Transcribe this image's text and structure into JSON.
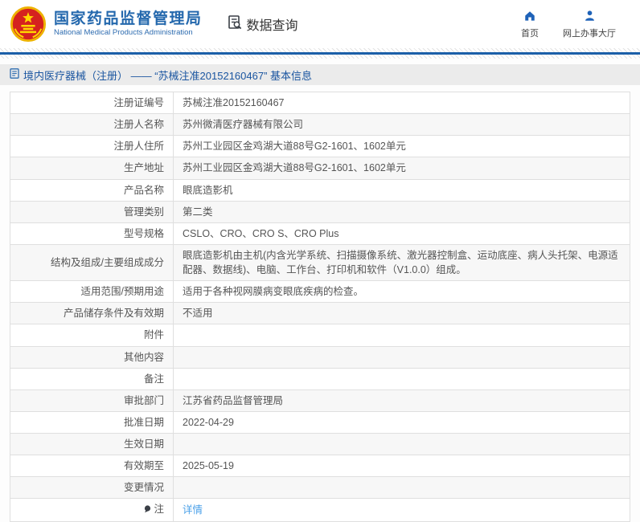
{
  "header": {
    "site_name_zh": "国家药品监督管理局",
    "site_name_en": "National Medical Products Administration",
    "section_title": "数据查询",
    "nav": [
      {
        "label": "首页",
        "icon": "home-icon"
      },
      {
        "label": "网上办事大厅",
        "icon": "person-icon"
      }
    ]
  },
  "breadcrumb": {
    "text": "境内医疗器械（注册） —— “苏械注准20152160467” 基本信息"
  },
  "registration_table": {
    "rows": [
      {
        "label": "注册证编号",
        "value": "苏械注准20152160467"
      },
      {
        "label": "注册人名称",
        "value": "苏州微清医疗器械有限公司"
      },
      {
        "label": "注册人住所",
        "value": "苏州工业园区金鸡湖大道88号G2-1601、1602单元"
      },
      {
        "label": "生产地址",
        "value": "苏州工业园区金鸡湖大道88号G2-1601、1602单元"
      },
      {
        "label": "产品名称",
        "value": "眼底造影机"
      },
      {
        "label": "管理类别",
        "value": "第二类"
      },
      {
        "label": "型号规格",
        "value": "CSLO、CRO、CRO S、CRO Plus"
      },
      {
        "label": "结构及组成/主要组成成分",
        "value": "眼底造影机由主机(内含光学系统、扫描摄像系统、激光器控制盒、运动底座、病人头托架、电源适配器、数据线)、电脑、工作台、打印机和软件（V1.0.0）组成。"
      },
      {
        "label": "适用范围/预期用途",
        "value": "适用于各种视网膜病变眼底疾病的检查。"
      },
      {
        "label": "产品储存条件及有效期",
        "value": "不适用"
      },
      {
        "label": "附件",
        "value": ""
      },
      {
        "label": "其他内容",
        "value": ""
      },
      {
        "label": "备注",
        "value": ""
      },
      {
        "label": "审批部门",
        "value": "江苏省药品监督管理局"
      },
      {
        "label": "批准日期",
        "value": "2022-04-29"
      },
      {
        "label": "生效日期",
        "value": ""
      },
      {
        "label": "有效期至",
        "value": "2025-05-19"
      },
      {
        "label": "变更情况",
        "value": ""
      },
      {
        "label": "注",
        "value": "详情",
        "value_type": "link",
        "label_icon": "note-icon"
      }
    ]
  },
  "icons": {
    "logo": "national-emblem",
    "data_query": "document-search-icon",
    "breadcrumb": "document-icon",
    "note_row": "note-icon"
  },
  "colors": {
    "accent_blue": "#1b5fa8",
    "title_blue": "#2468ad",
    "icon_blue": "#1e62b8",
    "link_blue": "#4aa0e8",
    "breadcrumb_bg": "#ebebeb",
    "zebra_row": "#f7f7f7",
    "text_gray": "#555555"
  }
}
